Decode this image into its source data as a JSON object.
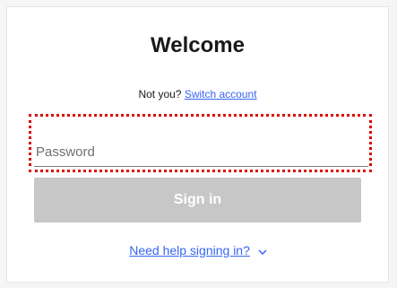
{
  "header": {
    "title": "Welcome"
  },
  "account": {
    "prompt": "Not you?",
    "switch_label": "Switch account"
  },
  "password": {
    "placeholder": "Password",
    "value": ""
  },
  "actions": {
    "signin_label": "Sign in"
  },
  "help": {
    "label": "Need help signing in?"
  },
  "colors": {
    "link": "#3665f3",
    "highlight": "#e00000",
    "button_disabled": "#c7c7c7"
  },
  "icons": {
    "help_toggle": "chevron-down-icon"
  }
}
